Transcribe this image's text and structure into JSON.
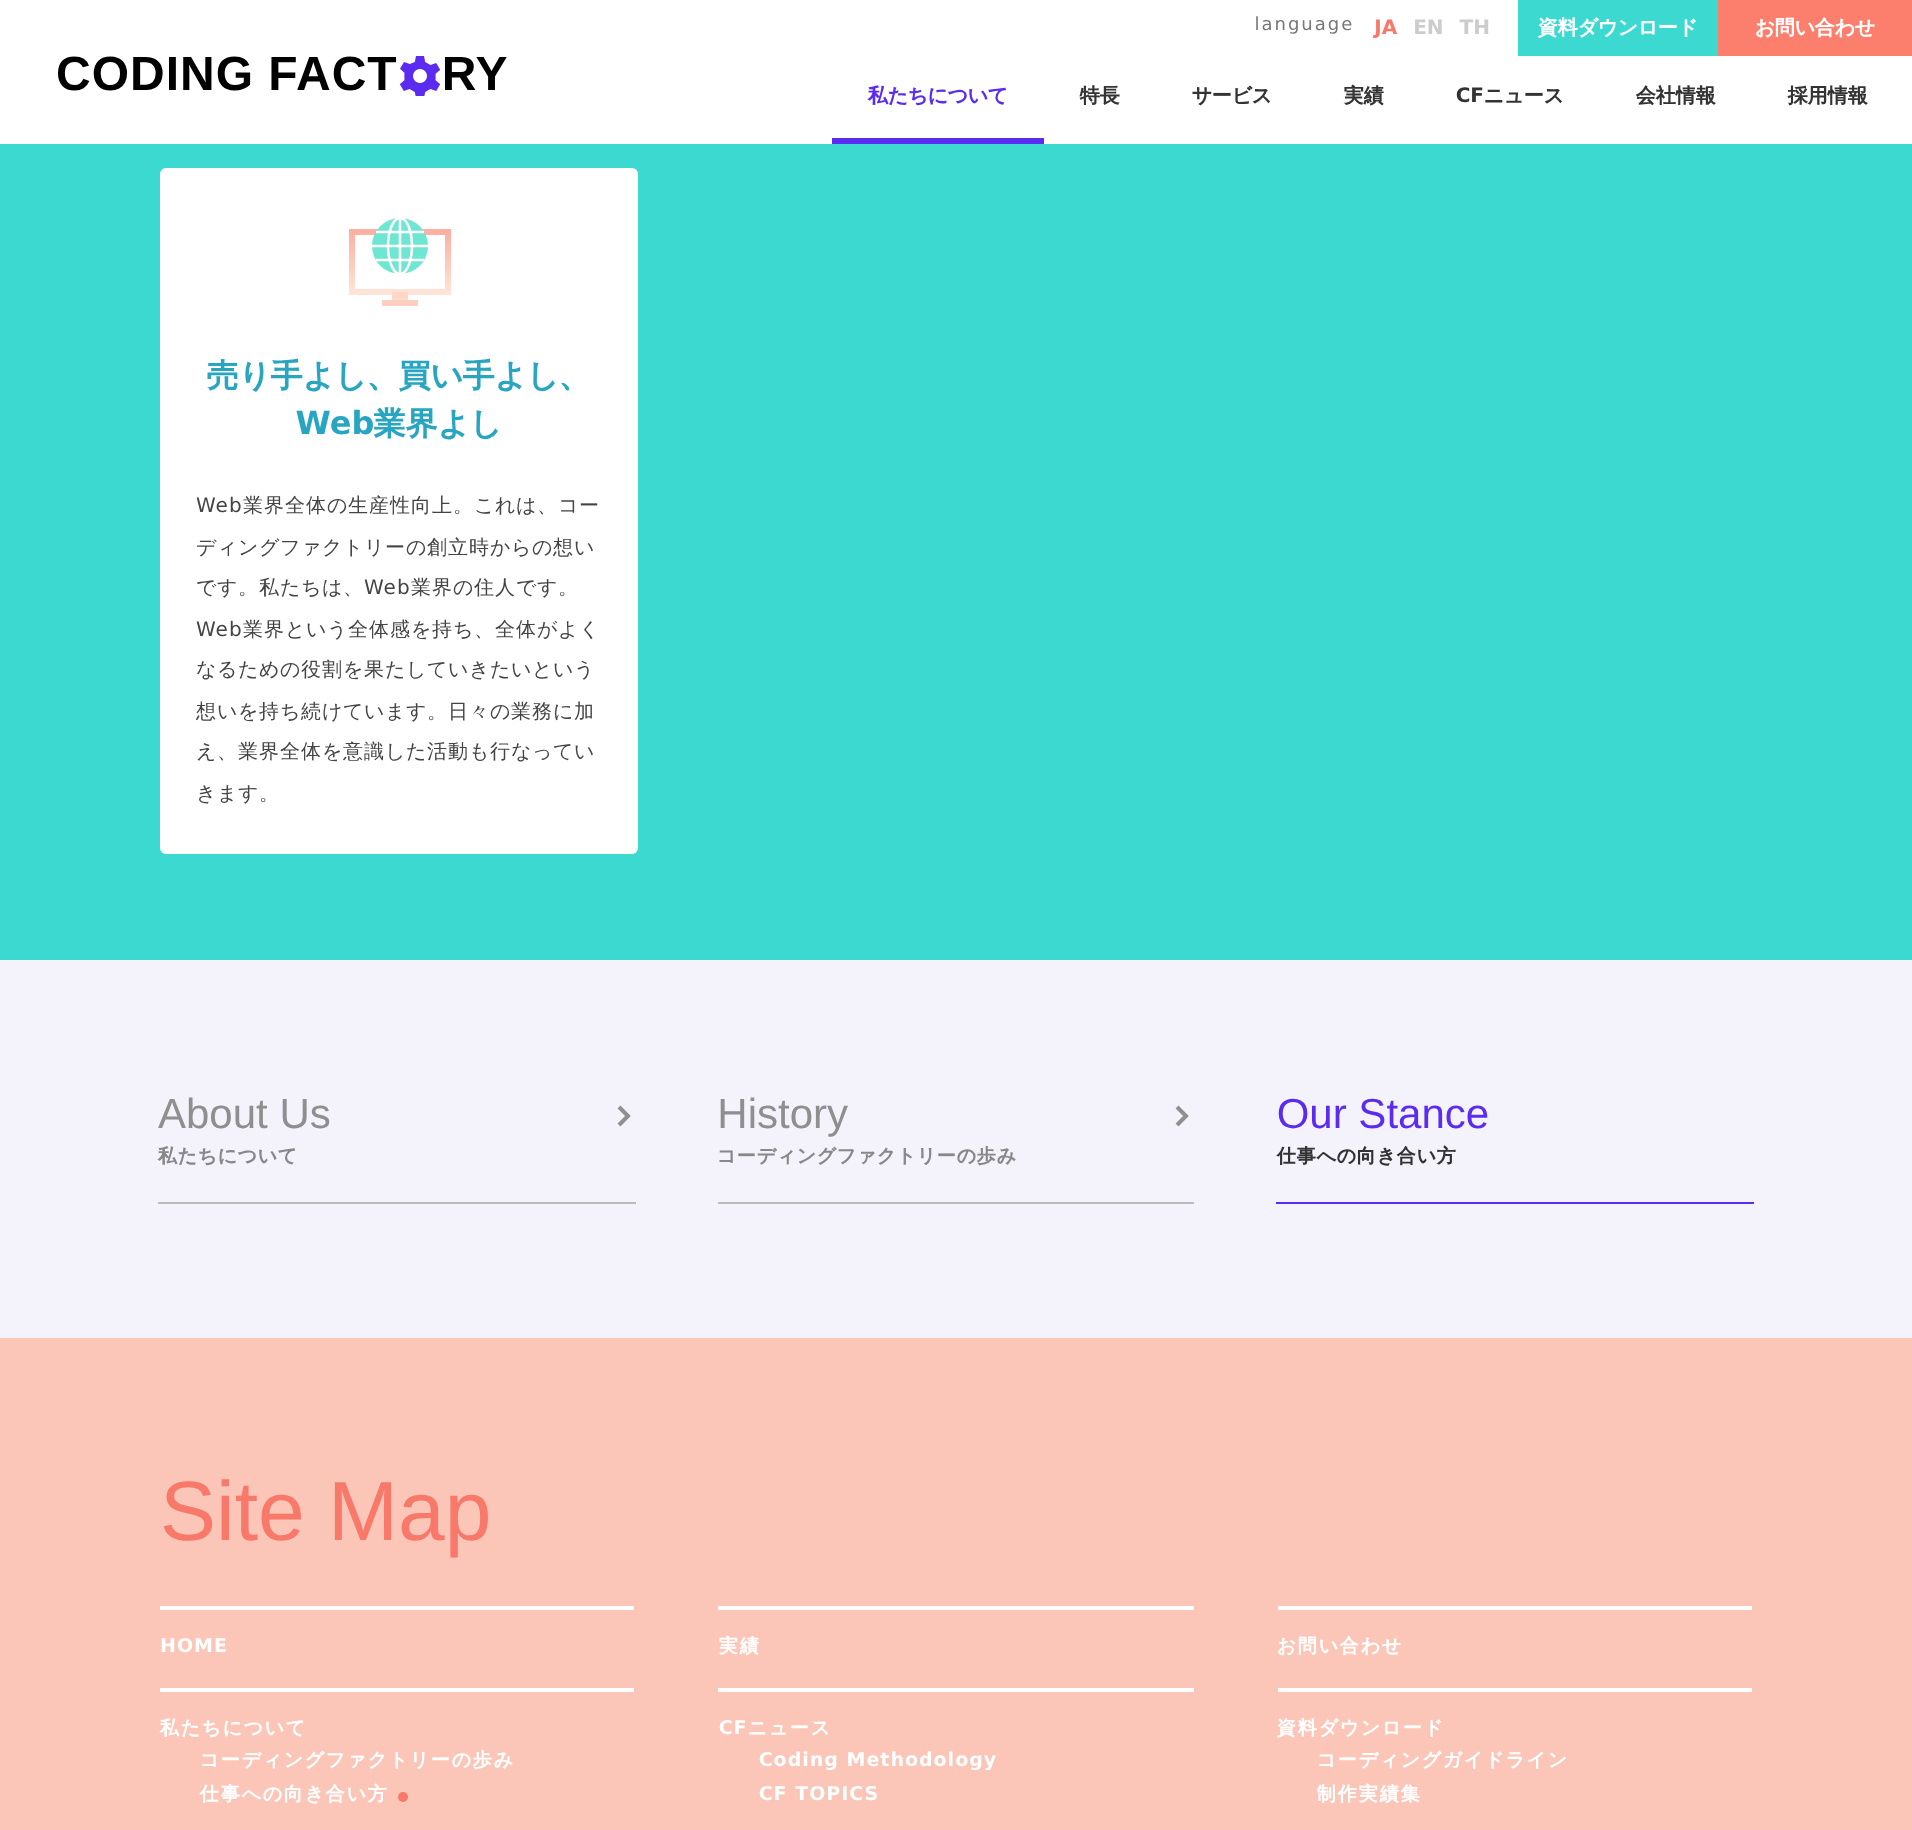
{
  "header": {
    "logo": {
      "before": "CODING FACT",
      "after": "RY"
    },
    "language": {
      "label": "language",
      "options": [
        {
          "label": "JA",
          "selected": true
        },
        {
          "label": "EN",
          "selected": false
        },
        {
          "label": "TH",
          "selected": false
        }
      ]
    },
    "buttons": [
      {
        "label": "資料ダウンロード",
        "kind": "download"
      },
      {
        "label": "お問い合わせ",
        "kind": "contact"
      }
    ],
    "nav": [
      {
        "label": "私たちについて",
        "selected": true
      },
      {
        "label": "特長",
        "selected": false
      },
      {
        "label": "サービス",
        "selected": false
      },
      {
        "label": "実績",
        "selected": false
      },
      {
        "label": "CFニュース",
        "selected": false
      },
      {
        "label": "会社情報",
        "selected": false
      },
      {
        "label": "採用情報",
        "selected": false
      }
    ]
  },
  "card": {
    "title": "売り手よし、買い手よし、\nWeb業界よし",
    "body": "Web業界全体の生産性向上。これは、コーディングファクトリーの創立時からの想いです。私たちは、Web業界の住人です。Web業界という全体感を持ち、全体がよくなるための役割を果たしていきたいという想いを持ち続けています。日々の業務に加え、業界全体を意識した活動も行なっていきます。"
  },
  "tabs": [
    {
      "title": "About Us",
      "subtitle": "私たちについて",
      "selected": false
    },
    {
      "title": "History",
      "subtitle": "コーディングファクトリーの歩み",
      "selected": false
    },
    {
      "title": "Our Stance",
      "subtitle": "仕事への向き合い方",
      "selected": true
    }
  ],
  "sitemap": {
    "title": "Site Map",
    "columns": [
      {
        "top": "HOME",
        "group": {
          "label": "私たちについて",
          "children": [
            {
              "label": "コーディングファクトリーの歩み",
              "current": false
            },
            {
              "label": "仕事への向き合い方",
              "current": true
            }
          ]
        }
      },
      {
        "top": "実績",
        "group": {
          "label": "CFニュース",
          "children": [
            {
              "label": "Coding Methodology",
              "current": false
            },
            {
              "label": "CF TOPICS",
              "current": false
            }
          ]
        }
      },
      {
        "top": "お問い合わせ",
        "group": {
          "label": "資料ダウンロード",
          "children": [
            {
              "label": "コーディングガイドライン",
              "current": false
            },
            {
              "label": "制作実績集",
              "current": false
            }
          ]
        }
      }
    ]
  }
}
